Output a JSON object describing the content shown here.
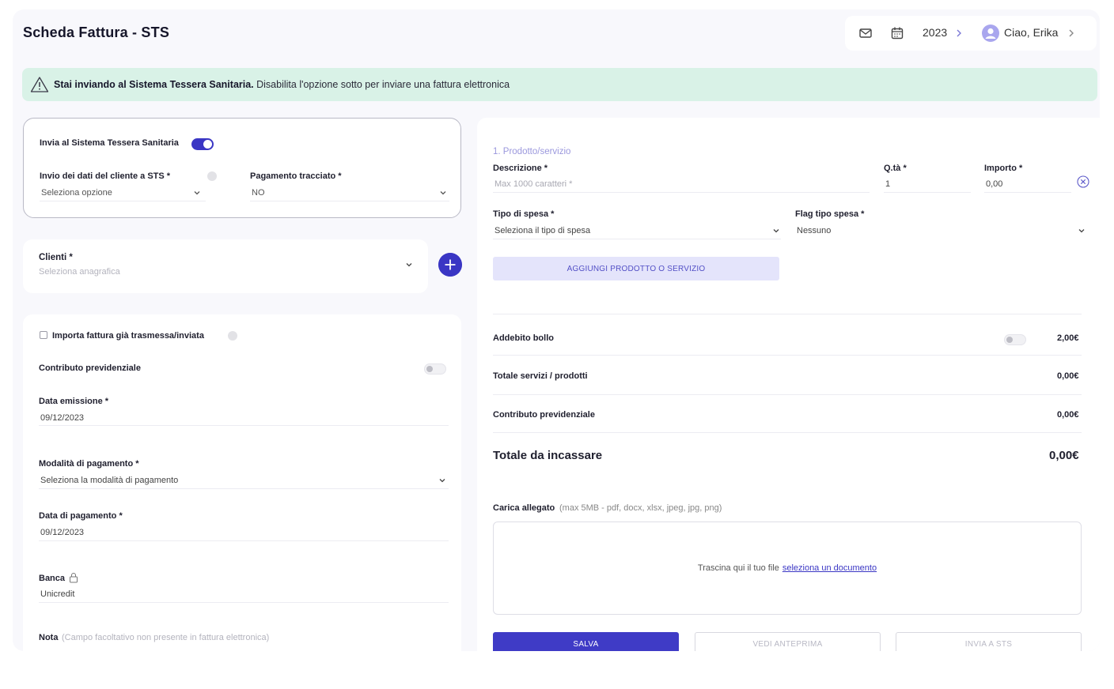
{
  "header": {
    "title": "Scheda Fattura - STS",
    "year": "2023",
    "greeting": "Ciao, Erika"
  },
  "banner": {
    "bold": "Stai inviando al Sistema Tessera Sanitaria.",
    "text": " Disabilita l'opzione sotto per inviare una fattura elettronica"
  },
  "sts_card": {
    "send_label": "Invia al Sistema Tessera Sanitaria",
    "send_enabled": true,
    "client_data_label": "Invio dei dati del cliente a STS *",
    "client_data_value": "Seleziona opzione",
    "tracked_payment_label": "Pagamento tracciato *",
    "tracked_payment_value": "NO"
  },
  "clients": {
    "label": "Clienti *",
    "placeholder": "Seleziona anagrafica"
  },
  "details": {
    "import_label": "Importa fattura già trasmessa/inviata",
    "contribution_label": "Contributo previdenziale",
    "issue_date_label": "Data emissione *",
    "issue_date_value": "09/12/2023",
    "payment_method_label": "Modalità di pagamento *",
    "payment_method_value": "Seleziona la modalità di pagamento",
    "payment_date_label": "Data di pagamento *",
    "payment_date_value": "09/12/2023",
    "bank_label": "Banca",
    "bank_value": "Unicredit",
    "note_label": "Nota",
    "note_hint": "(Campo facoltativo non presente in fattura elettronica)"
  },
  "product": {
    "section_title": "1. Prodotto/servizio",
    "description_label": "Descrizione *",
    "description_placeholder": "Max 1000 caratteri *",
    "qty_label": "Q.tà *",
    "qty_value": "1",
    "amount_label": "Importo *",
    "amount_value": "0,00",
    "expense_type_label": "Tipo di spesa *",
    "expense_type_value": "Seleziona il tipo di spesa",
    "flag_label": "Flag tipo spesa *",
    "flag_value": "Nessuno",
    "add_button": "AGGIUNGI PRODOTTO O SERVIZIO"
  },
  "summary": {
    "stamp_label": "Addebito bollo",
    "stamp_value": "2,00€",
    "services_label": "Totale servizi / prodotti",
    "services_value": "0,00€",
    "contribution_label": "Contributo previdenziale",
    "contribution_value": "0,00€",
    "total_label": "Totale da incassare",
    "total_value": "0,00€"
  },
  "attachment": {
    "label": "Carica allegato",
    "hint": "(max 5MB - pdf, docx, xlsx, jpeg, jpg, png)",
    "drop_text": "Trascina qui il tuo file",
    "drop_link": "seleziona un documento"
  },
  "actions": {
    "save": "SALVA",
    "preview": "VEDI ANTEPRIMA",
    "send": "INVIA A STS"
  },
  "colors": {
    "accent": "#3a36c4",
    "banner_bg": "#d9f2e7",
    "soft_button": "#e4e4fb"
  }
}
